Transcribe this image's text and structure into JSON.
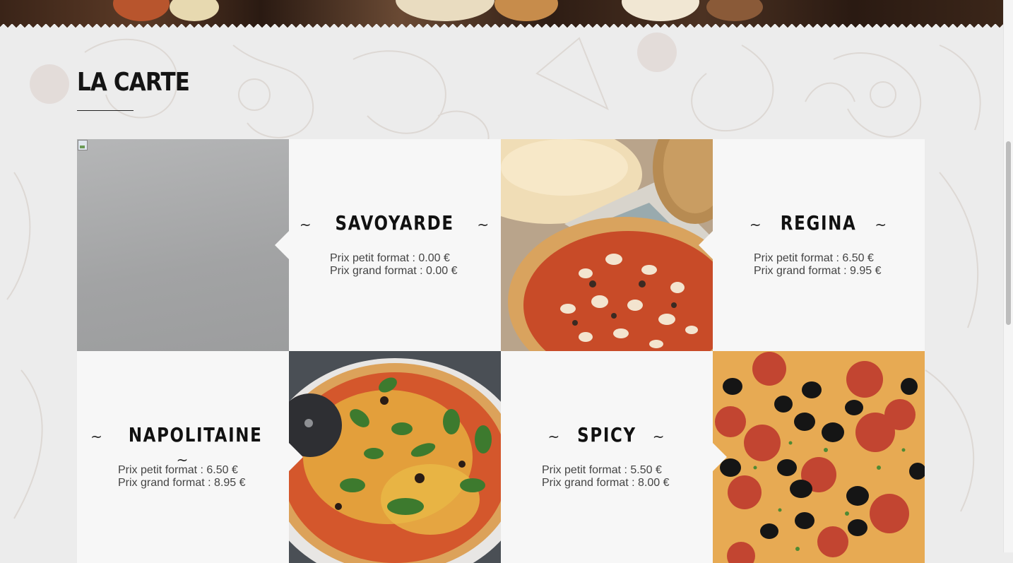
{
  "section": {
    "title": "LA CARTE"
  },
  "labels": {
    "tilde": "~"
  },
  "pizzas": [
    {
      "name": "SAVOYARDE",
      "petit": "Prix petit format : 0.00 €",
      "grand": "Prix grand format : 0.00 €",
      "image": "broken-image"
    },
    {
      "name": "REGINA",
      "petit": "Prix petit format : 6.50 €",
      "grand": "Prix grand format : 9.95 €",
      "image": "mushroom-pizza-photo"
    },
    {
      "name": "NAPOLITAINE",
      "petit": "Prix petit format : 6.50 €",
      "grand": "Prix grand format : 8.95 €",
      "image": "basil-pizza-photo"
    },
    {
      "name": "SPICY",
      "petit": "Prix petit format : 5.50 €",
      "grand": "Prix grand format : 8.00 €",
      "image": "pepperoni-olive-pizza-photo"
    }
  ],
  "colors": {
    "background": "#ececec",
    "card": "#f7f7f7",
    "title": "#141414",
    "price_text": "#444444"
  }
}
